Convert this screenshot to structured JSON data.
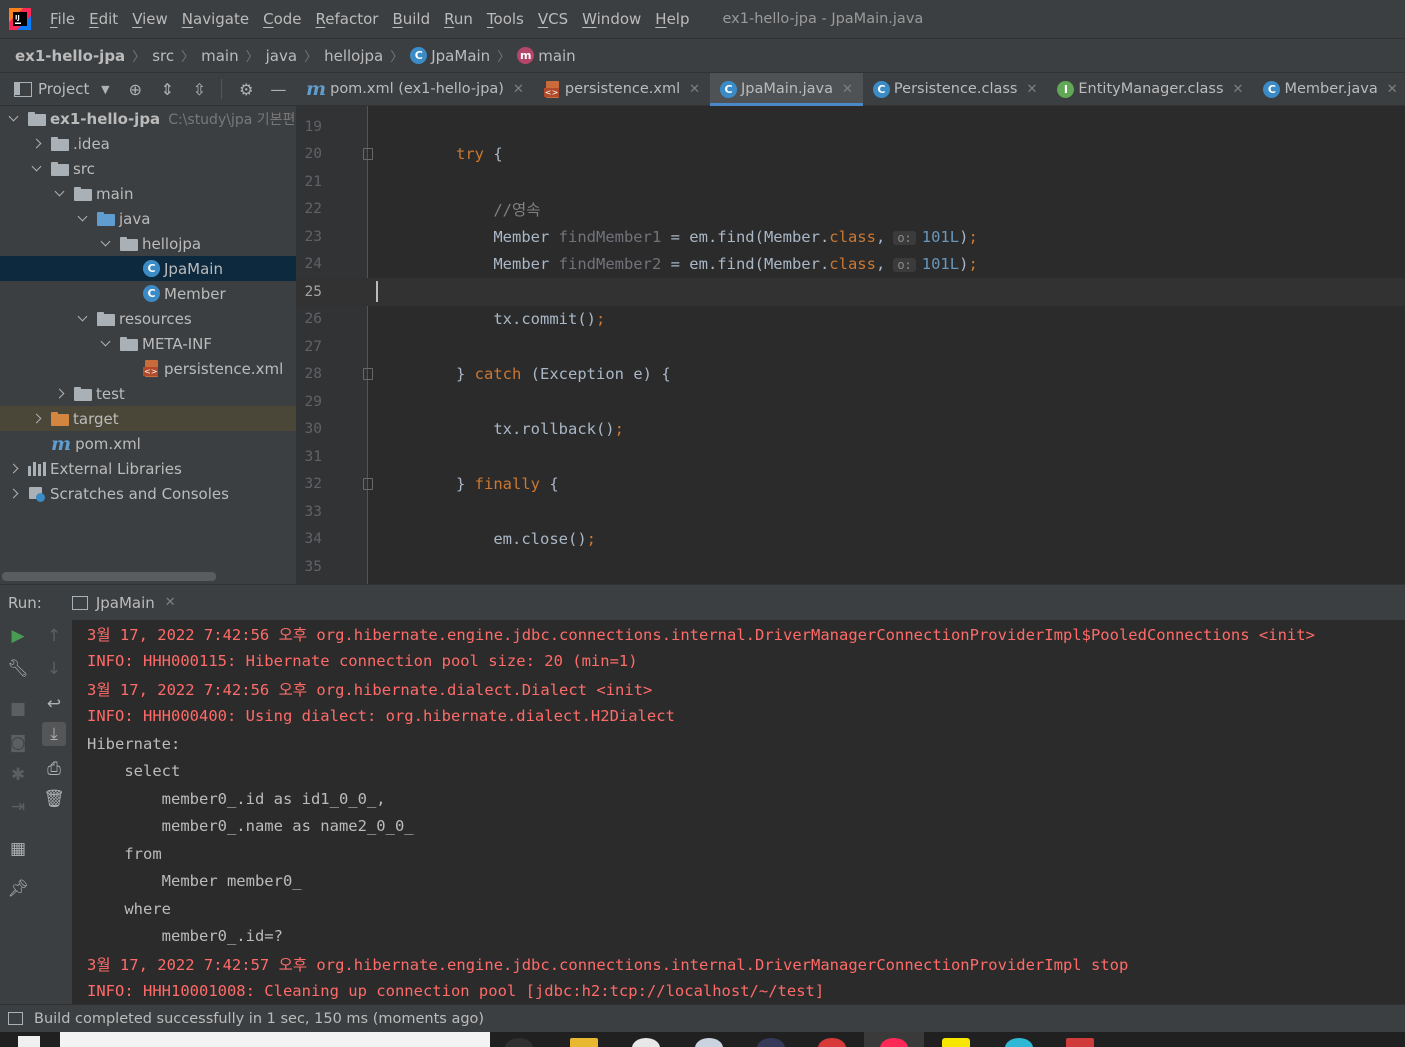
{
  "menubar": {
    "items": [
      "File",
      "Edit",
      "View",
      "Navigate",
      "Code",
      "Refactor",
      "Build",
      "Run",
      "Tools",
      "VCS",
      "Window",
      "Help"
    ],
    "window_title": "ex1-hello-jpa - JpaMain.java"
  },
  "breadcrumb": {
    "items": [
      "ex1-hello-jpa",
      "src",
      "main",
      "java",
      "hellojpa",
      "JpaMain",
      "main"
    ]
  },
  "project_panel": {
    "title": "Project",
    "tree": [
      {
        "label": "ex1-hello-jpa",
        "path": "C:\\study\\jpa 기본편",
        "icon": "module-folder-icon",
        "depth": 0,
        "expanded": true
      },
      {
        "label": ".idea",
        "icon": "folder-icon",
        "depth": 1,
        "expanded": false
      },
      {
        "label": "src",
        "icon": "folder-icon",
        "depth": 1,
        "expanded": true
      },
      {
        "label": "main",
        "icon": "folder-icon",
        "depth": 2,
        "expanded": true
      },
      {
        "label": "java",
        "icon": "source-folder-icon",
        "depth": 3,
        "expanded": true
      },
      {
        "label": "hellojpa",
        "icon": "package-icon",
        "depth": 4,
        "expanded": true
      },
      {
        "label": "JpaMain",
        "icon": "class-run-icon",
        "depth": 5,
        "selected": true
      },
      {
        "label": "Member",
        "icon": "class-icon",
        "depth": 5
      },
      {
        "label": "resources",
        "icon": "resources-folder-icon",
        "depth": 3,
        "expanded": true
      },
      {
        "label": "META-INF",
        "icon": "folder-icon",
        "depth": 4,
        "expanded": true
      },
      {
        "label": "persistence.xml",
        "icon": "xml-file-icon",
        "depth": 5
      },
      {
        "label": "test",
        "icon": "folder-icon",
        "depth": 2,
        "expanded": false
      },
      {
        "label": "target",
        "icon": "excluded-folder-icon",
        "depth": 1,
        "expanded": false
      },
      {
        "label": "pom.xml",
        "icon": "maven-icon",
        "depth": 1
      },
      {
        "label": "External Libraries",
        "icon": "libraries-icon",
        "depth": 0,
        "expanded": false
      },
      {
        "label": "Scratches and Consoles",
        "icon": "scratches-icon",
        "depth": 0,
        "expanded": false
      }
    ]
  },
  "editor_tabs": [
    {
      "label": "pom.xml (ex1-hello-jpa)",
      "icon": "maven-icon",
      "active": false
    },
    {
      "label": "persistence.xml",
      "icon": "xml-file-icon",
      "active": false
    },
    {
      "label": "JpaMain.java",
      "icon": "class-run-icon",
      "active": true
    },
    {
      "label": "Persistence.class",
      "icon": "class-icon",
      "active": false
    },
    {
      "label": "EntityManager.class",
      "icon": "interface-icon",
      "active": false
    },
    {
      "label": "Member.java",
      "icon": "class-icon",
      "active": false
    }
  ],
  "editor": {
    "current_line": 25,
    "lines": [
      {
        "n": "19",
        "html": ""
      },
      {
        "n": "20",
        "html": "<span class=\"kw\">try</span> {"
      },
      {
        "n": "21",
        "html": ""
      },
      {
        "n": "22",
        "html": "    <span class=\"cm\">//영속</span>"
      },
      {
        "n": "23",
        "html": "    Member <span class=\"unused\">findMember1</span> = em.find(Member.<span class=\"kw\">class</span>,<span class=\"hint\">o:</span><span class=\"num\">101L</span>)<span class=\"kw\">;</span>"
      },
      {
        "n": "24",
        "html": "    Member <span class=\"unused\">findMember2</span> = em.find(Member.<span class=\"kw\">class</span>,<span class=\"hint\">o:</span><span class=\"num\">101L</span>)<span class=\"kw\">;</span>"
      },
      {
        "n": "25",
        "html": ""
      },
      {
        "n": "26",
        "html": "    tx.commit()<span class=\"kw\">;</span>"
      },
      {
        "n": "27",
        "html": ""
      },
      {
        "n": "28",
        "html": "} <span class=\"kw\">catch</span> (Exception e) {"
      },
      {
        "n": "29",
        "html": ""
      },
      {
        "n": "30",
        "html": "    tx.rollback()<span class=\"kw\">;</span>"
      },
      {
        "n": "31",
        "html": ""
      },
      {
        "n": "32",
        "html": "} <span class=\"kw\">finally</span> {"
      },
      {
        "n": "33",
        "html": ""
      },
      {
        "n": "34",
        "html": "    em.close()<span class=\"kw\">;</span>"
      },
      {
        "n": "35",
        "html": ""
      }
    ]
  },
  "run_panel": {
    "label": "Run:",
    "tab": "JpaMain",
    "console": [
      {
        "text": "3월 17, 2022 7:42:56 오후 org.hibernate.engine.jdbc.connections.internal.DriverManagerConnectionProviderImpl$PooledConnections <init>",
        "kind": "err"
      },
      {
        "text": "INFO: HHH000115: Hibernate connection pool size: 20 (min=1)",
        "kind": "err"
      },
      {
        "text": "3월 17, 2022 7:42:56 오후 org.hibernate.dialect.Dialect <init>",
        "kind": "err"
      },
      {
        "text": "INFO: HHH000400: Using dialect: org.hibernate.dialect.H2Dialect",
        "kind": "err"
      },
      {
        "text": "Hibernate: ",
        "kind": "out"
      },
      {
        "text": "    select",
        "kind": "out"
      },
      {
        "text": "        member0_.id as id1_0_0_,",
        "kind": "out"
      },
      {
        "text": "        member0_.name as name2_0_0_ ",
        "kind": "out"
      },
      {
        "text": "    from",
        "kind": "out"
      },
      {
        "text": "        Member member0_ ",
        "kind": "out"
      },
      {
        "text": "    where",
        "kind": "out"
      },
      {
        "text": "        member0_.id=?",
        "kind": "out"
      },
      {
        "text": "3월 17, 2022 7:42:57 오후 org.hibernate.engine.jdbc.connections.internal.DriverManagerConnectionProviderImpl stop",
        "kind": "err"
      },
      {
        "text": "INFO: HHH10001008: Cleaning up connection pool [jdbc:h2:tcp://localhost/~/test]",
        "kind": "err"
      }
    ]
  },
  "statusbar": {
    "text": "Build completed successfully in 1 sec, 150 ms (moments ago)"
  },
  "colors": {
    "accent": "#4a88c7",
    "error_text": "#ff6b68",
    "keyword": "#cc7832",
    "number": "#6897bb",
    "background": "#2b2b2b",
    "panel": "#3c3f41"
  }
}
